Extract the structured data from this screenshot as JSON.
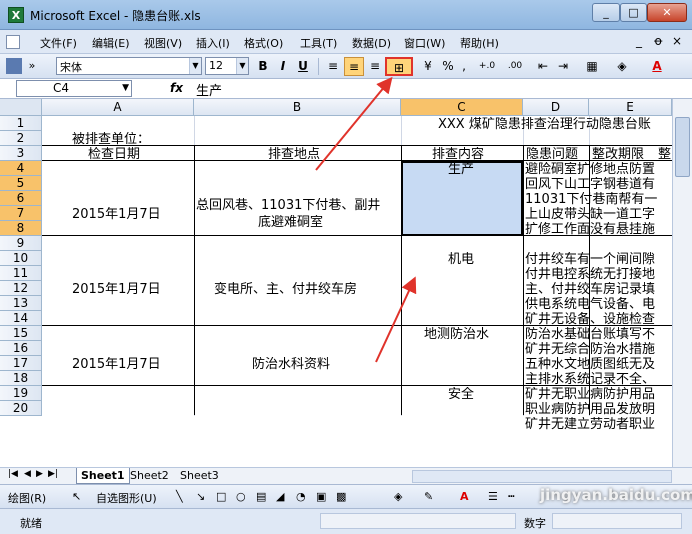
{
  "window": {
    "title": "Microsoft Excel - 隐患台账.xls",
    "min": "_",
    "max": "□",
    "close": "✕"
  },
  "menu": {
    "items": [
      "文件(F)",
      "编辑(E)",
      "视图(V)",
      "插入(I)",
      "格式(O)",
      "工具(T)",
      "数据(D)",
      "窗口(W)",
      "帮助(H)"
    ],
    "right_minimize": "_",
    "right_restore": "ꝋ",
    "right_close": "×"
  },
  "toolbar": {
    "font_name": "宋体",
    "font_size": "12",
    "bold": "B",
    "italic": "I",
    "underline": "U",
    "percent": "%",
    "comma": ",",
    "inc_decimal": "+.0 .00",
    "dec_decimal": ".00 +.0",
    "font_color_label": "A"
  },
  "formula_bar": {
    "name_box": "C4",
    "fx": "fx",
    "value": "生产"
  },
  "columns": [
    "A",
    "B",
    "C",
    "D",
    "E"
  ],
  "rows": [
    "1",
    "2",
    "3",
    "4",
    "5",
    "6",
    "7",
    "8",
    "9",
    "10",
    "11",
    "12",
    "13",
    "14",
    "15",
    "16",
    "17",
    "18",
    "19",
    "20"
  ],
  "cells": {
    "r1_title": "XXX 煤矿隐患排查治理行动隐患台账",
    "r2_unit": "被排查单位：",
    "hdr_date": "检查日期",
    "hdr_place": "排查地点",
    "hdr_content": "排查内容",
    "hdr_issue": "隐患问题",
    "hdr_deadline": "整改期限",
    "hdr_more": "整",
    "date1": "2015年1月7日",
    "place1_line1": "总回风巷、11031下付巷、副井",
    "place1_line2": "底避难硐室",
    "content1": "生产",
    "d4": "避险硐室扩修地点防置",
    "d5": "回风下山工字钢巷道有",
    "d6": "11031下付巷南帮有一",
    "d7": "上山皮带头缺一道工字",
    "d8": "扩修工作面没有悬挂施",
    "date2": "2015年1月7日",
    "place2": "变电所、主、付井绞车房",
    "content2": "机电",
    "d9": "付井绞车有一个闸间隙",
    "d10": "付井电控系统无打接地",
    "d11": "主、付井绞车房记录填",
    "d12": "供电系统电气设备、电",
    "d13": "矿井无设备、设施检查",
    "date3": "2015年1月7日",
    "place3": "防治水科资料",
    "content3": "地测防治水",
    "d14": "防治水基础台账填写不",
    "d15": "矿井无综合防治水措施",
    "d16": "五种水文地质图纸无及",
    "d17": "主排水系统记录不全、",
    "content4": "安全",
    "d18": "矿井无职业病防护用品",
    "d19": "职业病防护用品发放明",
    "d20": "矿井无建立劳动者职业"
  },
  "sheets": [
    "Sheet1",
    "Sheet2",
    "Sheet3"
  ],
  "draw_toolbar": {
    "draw": "绘图(R)",
    "autoshape": "自选图形(U)"
  },
  "status": {
    "ready": "就绪",
    "num": "数字"
  },
  "watermark": "jingyan.baidu.com",
  "colors": {
    "selection_fill": "#c7daf3",
    "header_selected": "#f8c26a",
    "annotation_red": "#e0332b",
    "titlebar": "#a9c9ea"
  }
}
